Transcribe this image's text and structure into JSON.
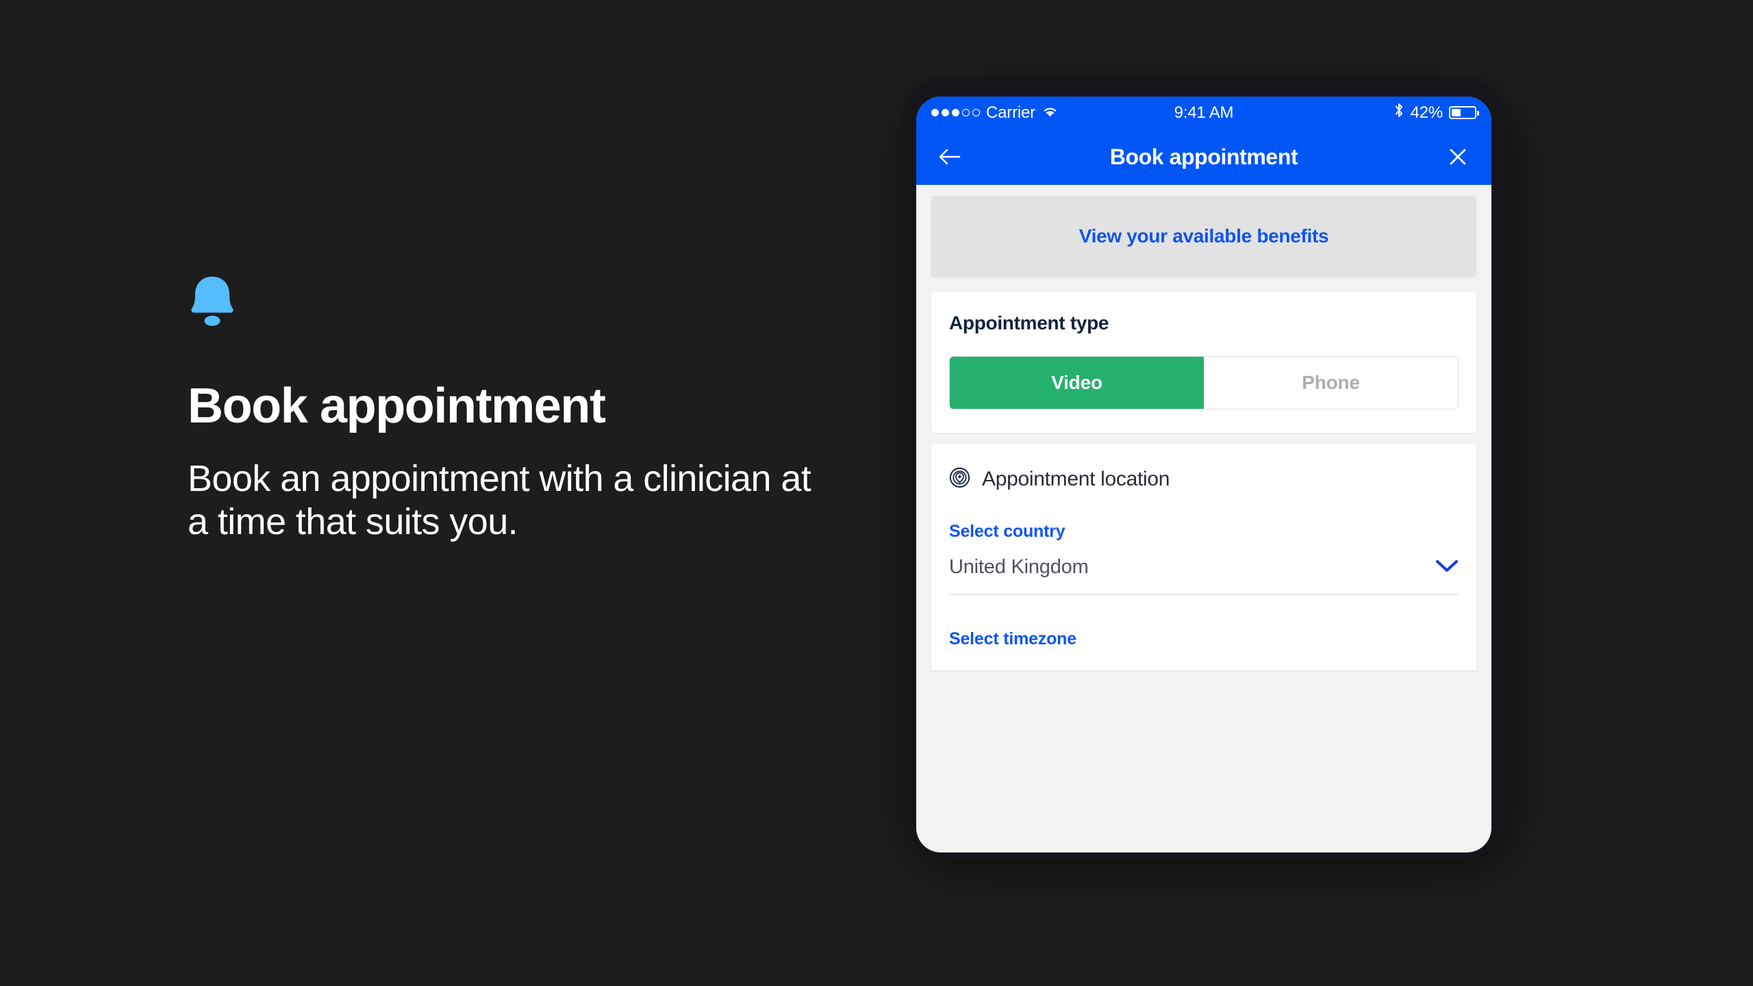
{
  "promo": {
    "icon": "bell-icon",
    "title": "Book appointment",
    "body": "Book an appointment with a clinician at a time that suits you."
  },
  "colors": {
    "background": "#1d1d1d",
    "bell": "#55bdfc",
    "header_blue": "#0055f5",
    "link_blue": "#0f54f0",
    "accent_green": "#25b06e",
    "screen_bg": "#f2f2f2",
    "card_bg": "#ffffff",
    "banner_bg": "#e2e2e2"
  },
  "phone": {
    "statusbar": {
      "signal_dots_filled": 3,
      "signal_dots_total": 5,
      "carrier": "Carrier",
      "wifi_icon": "wifi-icon",
      "time": "9:41 AM",
      "bluetooth_icon": "bluetooth-icon",
      "battery_percent": "42%",
      "battery_level": 42
    },
    "appbar": {
      "back_icon": "arrow-left-icon",
      "title": "Book appointment",
      "close_icon": "close-icon"
    },
    "content": {
      "benefits_banner": {
        "label": "View your available benefits"
      },
      "appointment_type": {
        "title": "Appointment type",
        "options": [
          {
            "label": "Video",
            "selected": true
          },
          {
            "label": "Phone",
            "selected": false
          }
        ]
      },
      "appointment_location": {
        "icon": "location-target-icon",
        "title": "Appointment location",
        "country": {
          "label": "Select country",
          "value": "United Kingdom",
          "chevron_icon": "chevron-down-icon"
        },
        "timezone": {
          "label": "Select timezone"
        }
      }
    }
  }
}
